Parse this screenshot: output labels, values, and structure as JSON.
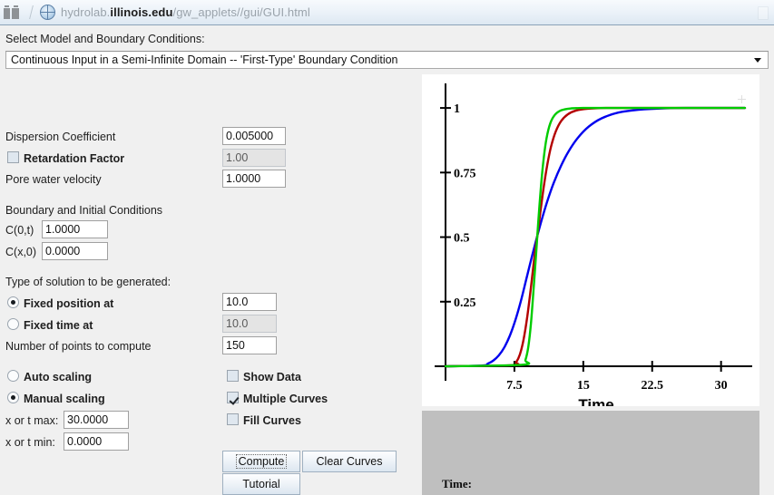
{
  "browser": {
    "tabs_icon": "tabs-icon",
    "favicon": "globe-icon",
    "url_domain_dim": "hydrolab.",
    "url_domain_bold": "illinois.edu",
    "url_path": "/gw_applets//gui/GUI.html"
  },
  "model_select": {
    "label": "Select Model and Boundary Conditions:",
    "selected": "Continuous Input in a Semi-Infinite Domain -- 'First-Type' Boundary Condition",
    "arrow_icon": "chevron-down-icon"
  },
  "parameters": {
    "dispersion_label": "Dispersion Coefficient",
    "dispersion_value": "0.005000",
    "retardation_label": "Retardation Factor",
    "retardation_value": "1.00",
    "retardation_checked": false,
    "velocity_label": "Pore water velocity",
    "velocity_value": "1.0000"
  },
  "conditions": {
    "heading": "Boundary and Initial Conditions",
    "c0t_label": "C(0,t)",
    "c0t_value": "1.0000",
    "cx0_label": "C(x,0)",
    "cx0_value": "0.0000"
  },
  "solution": {
    "heading": "Type of solution to be generated:",
    "fixed_position_label": "Fixed position at",
    "fixed_position_value": "10.0",
    "fixed_position_selected": true,
    "fixed_time_label": "Fixed time at",
    "fixed_time_value": "10.0",
    "fixed_time_selected": false,
    "points_label": "Number of points to compute",
    "points_value": "150"
  },
  "scaling": {
    "auto_label": "Auto scaling",
    "auto_selected": false,
    "manual_label": "Manual scaling",
    "manual_selected": true,
    "max_label": "x or t max:",
    "max_value": "30.0000",
    "min_label": "x or t min:",
    "min_value": "0.0000"
  },
  "display_options": {
    "show_data_label": "Show Data",
    "show_data_checked": false,
    "multiple_curves_label": "Multiple Curves",
    "multiple_curves_checked": true,
    "fill_curves_label": "Fill Curves",
    "fill_curves_checked": false
  },
  "actions": {
    "compute_label": "Compute",
    "clear_label": "Clear Curves",
    "tutorial_label": "Tutorial"
  },
  "status": {
    "time_label": "Time:"
  },
  "chart_data": {
    "type": "line",
    "title": "",
    "xlabel": "Time",
    "ylabel": "",
    "xlim": [
      0,
      32.8
    ],
    "ylim": [
      0,
      1.06
    ],
    "xticks": [
      7.5,
      15,
      22.5,
      30
    ],
    "xticklabels": [
      "7.5",
      "15",
      "22.5",
      "30"
    ],
    "yticks": [
      0.25,
      0.5,
      0.75,
      1
    ],
    "yticklabels": [
      "0.25",
      "0.5",
      "0.75",
      "1"
    ],
    "grid": false,
    "legend": "none",
    "series": [
      {
        "name": "curve-1",
        "color": "#0000ee",
        "x": [
          0,
          4.0,
          4.6,
          5.2,
          5.8,
          6.4,
          7.0,
          7.6,
          8.2,
          8.8,
          9.4,
          10.0,
          10.6,
          11.2,
          11.8,
          12.6,
          13.4,
          14.4,
          15.6,
          17.0,
          18.8,
          21.0,
          24.0,
          27.0,
          30.0,
          32.6
        ],
        "y": [
          0.0,
          0.003,
          0.01,
          0.022,
          0.042,
          0.073,
          0.118,
          0.178,
          0.252,
          0.338,
          0.424,
          0.506,
          0.583,
          0.652,
          0.712,
          0.778,
          0.832,
          0.884,
          0.928,
          0.96,
          0.982,
          0.993,
          0.999,
          1.0,
          1.0,
          1.0
        ]
      },
      {
        "name": "curve-2",
        "color": "#b30000",
        "x": [
          0,
          7.3,
          7.7,
          8.1,
          8.5,
          8.9,
          9.3,
          9.7,
          10.0,
          10.3,
          10.7,
          11.1,
          11.5,
          12.0,
          12.6,
          13.3,
          14.2,
          15.5,
          17.5,
          20.0,
          24.0,
          28.0,
          32.6
        ],
        "y": [
          0.0,
          0.004,
          0.016,
          0.046,
          0.104,
          0.192,
          0.305,
          0.43,
          0.506,
          0.59,
          0.696,
          0.784,
          0.852,
          0.909,
          0.95,
          0.975,
          0.99,
          0.997,
          1.0,
          1.0,
          1.0,
          1.0,
          1.0
        ]
      },
      {
        "name": "curve-3",
        "color": "#00cc00",
        "x": [
          0,
          8.4,
          8.7,
          9.0,
          9.3,
          9.6,
          9.9,
          10.1,
          10.4,
          10.7,
          11.0,
          11.4,
          11.9,
          12.6,
          13.6,
          15.0,
          17.5,
          21.0,
          26.0,
          32.6
        ],
        "y": [
          0.0,
          0.006,
          0.024,
          0.072,
          0.165,
          0.305,
          0.455,
          0.56,
          0.7,
          0.808,
          0.883,
          0.94,
          0.973,
          0.991,
          0.998,
          1.0,
          1.0,
          1.0,
          1.0,
          1.0
        ]
      }
    ]
  }
}
